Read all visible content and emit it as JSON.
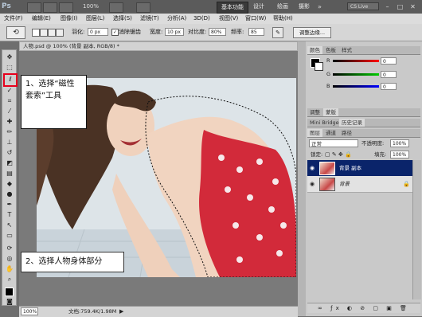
{
  "app": {
    "logo": "Ps",
    "zoom": "100%",
    "workspaces": [
      "基本功能",
      "设计",
      "绘画",
      "摄影"
    ],
    "active_workspace": 0,
    "cs_live": "CS Live"
  },
  "menu": [
    "文件(F)",
    "编辑(E)",
    "图像(I)",
    "图层(L)",
    "选择(S)",
    "滤镜(T)",
    "分析(A)",
    "3D(D)",
    "视图(V)",
    "窗口(W)",
    "帮助(H)"
  ],
  "options": {
    "feather_label": "羽化:",
    "feather_value": "0 px",
    "antialias_label": "消除锯齿",
    "width_label": "宽度:",
    "width_value": "10 px",
    "contrast_label": "对比度:",
    "contrast_value": "80%",
    "frequency_label": "频率:",
    "frequency_value": "85",
    "refine_label": "调整边缘..."
  },
  "document": {
    "tab_title": "人物.psd @ 100% (背景 副本, RGB/8) *",
    "zoom": "100%",
    "doc_info": "文档:759.4K/1.98M"
  },
  "callouts": {
    "first": "1、选择“磁性套索”工具",
    "second": "2、选择人物身体部分"
  },
  "panels": {
    "color_tabs": [
      "颜色",
      "色板",
      "样式"
    ],
    "channels": [
      {
        "label": "R",
        "value": "0"
      },
      {
        "label": "G",
        "value": "0"
      },
      {
        "label": "B",
        "value": "0"
      }
    ],
    "adjust_tabs": [
      "调整",
      "蒙版"
    ],
    "bridge_tabs": [
      "Mini Bridge",
      "历史记录"
    ],
    "layer_tabs": [
      "图层",
      "通道",
      "路径"
    ],
    "blend_mode": "正常",
    "opacity_label": "不透明度:",
    "opacity_value": "100%",
    "lock_label": "锁定:",
    "fill_label": "填充:",
    "fill_value": "100%",
    "layers": [
      {
        "name": "背景 副本",
        "selected": true
      },
      {
        "name": "背景",
        "selected": false
      }
    ]
  },
  "colors": {
    "accent": "#0a246a",
    "callout_border": "#e8001c"
  }
}
